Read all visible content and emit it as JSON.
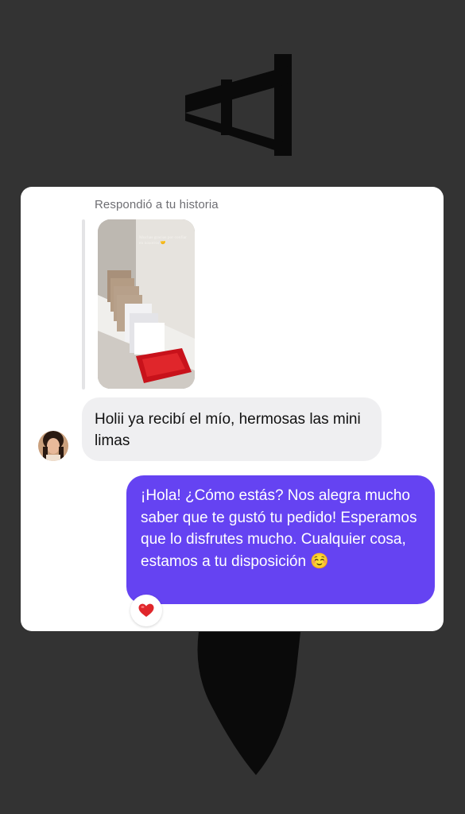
{
  "story_reply": {
    "label": "Respondió a tu historia",
    "story_caption": "Muchas gracias por confiar en nosotros 🤝"
  },
  "messages": [
    {
      "sender": "contact",
      "text": "Holii ya recibí el mío, hermosas las mini limas"
    },
    {
      "sender": "me",
      "text": "¡Hola! ¿Cómo estás? Nos alegra mucho saber que te gustó tu pedido! Esperamos que lo disfrutes mucho. Cualquier cosa, estamos a tu disposición ☺️",
      "reaction": "heart"
    }
  ],
  "colors": {
    "background": "#333333",
    "card": "#ffffff",
    "incoming_bubble": "#efeff1",
    "outgoing_bubble": "#6543f2",
    "reaction_heart": "#e0262b"
  }
}
